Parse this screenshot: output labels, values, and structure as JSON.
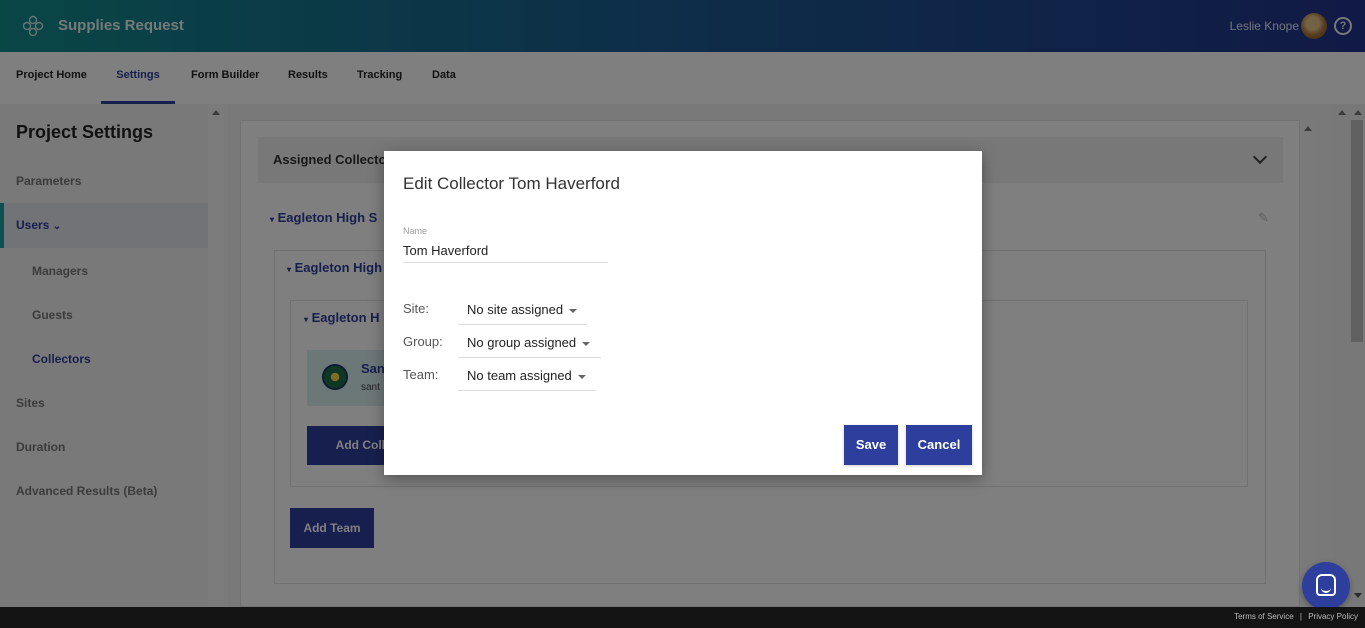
{
  "header": {
    "app_title": "Supplies Request",
    "user_name": "Leslie Knope",
    "help_glyph": "?"
  },
  "nav": {
    "tabs": [
      "Project Home",
      "Settings",
      "Form Builder",
      "Results",
      "Tracking",
      "Data"
    ],
    "active": "Settings"
  },
  "sidebar": {
    "title": "Project Settings",
    "items": [
      "Parameters",
      "Users",
      "Managers",
      "Guests",
      "Collectors",
      "Sites",
      "Duration",
      "Advanced Results (Beta)"
    ],
    "users_caret": "⌄"
  },
  "main": {
    "assigned_label": "Assigned Collecto",
    "site_label": "Eagleton High S",
    "group_label": "Eagleton High",
    "team_label": "Eagleton H",
    "collector_name": "San",
    "collector_email": "sant",
    "add_collector_label": "Add Collec",
    "add_team_label": "Add Team"
  },
  "modal": {
    "title": "Edit Collector Tom Haverford",
    "name_label": "Name",
    "name_value": "Tom Haverford",
    "site_label": "Site:",
    "site_value": "No site assigned",
    "group_label": "Group:",
    "group_value": "No group assigned",
    "team_label": "Team:",
    "team_value": "No team assigned",
    "save_label": "Save",
    "cancel_label": "Cancel"
  },
  "footer": {
    "terms": "Terms of Service",
    "separator": "|",
    "privacy": "Privacy Policy"
  },
  "colors": {
    "brand": "#2e3e9c",
    "teal": "#128c8c",
    "overlay": "rgba(0,0,0,0.5)"
  },
  "icons": [
    "logo-icon",
    "avatar",
    "help-icon",
    "chevron-down-icon",
    "pencil-icon",
    "caret-down-icon",
    "chat-icon"
  ]
}
